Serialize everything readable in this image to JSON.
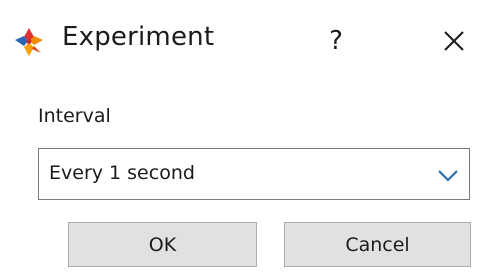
{
  "window": {
    "title": "Experiment",
    "help_label": "?"
  },
  "icons": {
    "app_icon": "flower-app-icon",
    "close_icon": "close-icon",
    "dropdown_icon": "chevron-down-icon"
  },
  "form": {
    "interval_label": "Interval",
    "interval_value": "Every 1 second"
  },
  "buttons": {
    "ok_label": "OK",
    "cancel_label": "Cancel"
  },
  "colors": {
    "combo_arrow": "#2e6bb5",
    "button_bg": "#e1e1e1"
  }
}
